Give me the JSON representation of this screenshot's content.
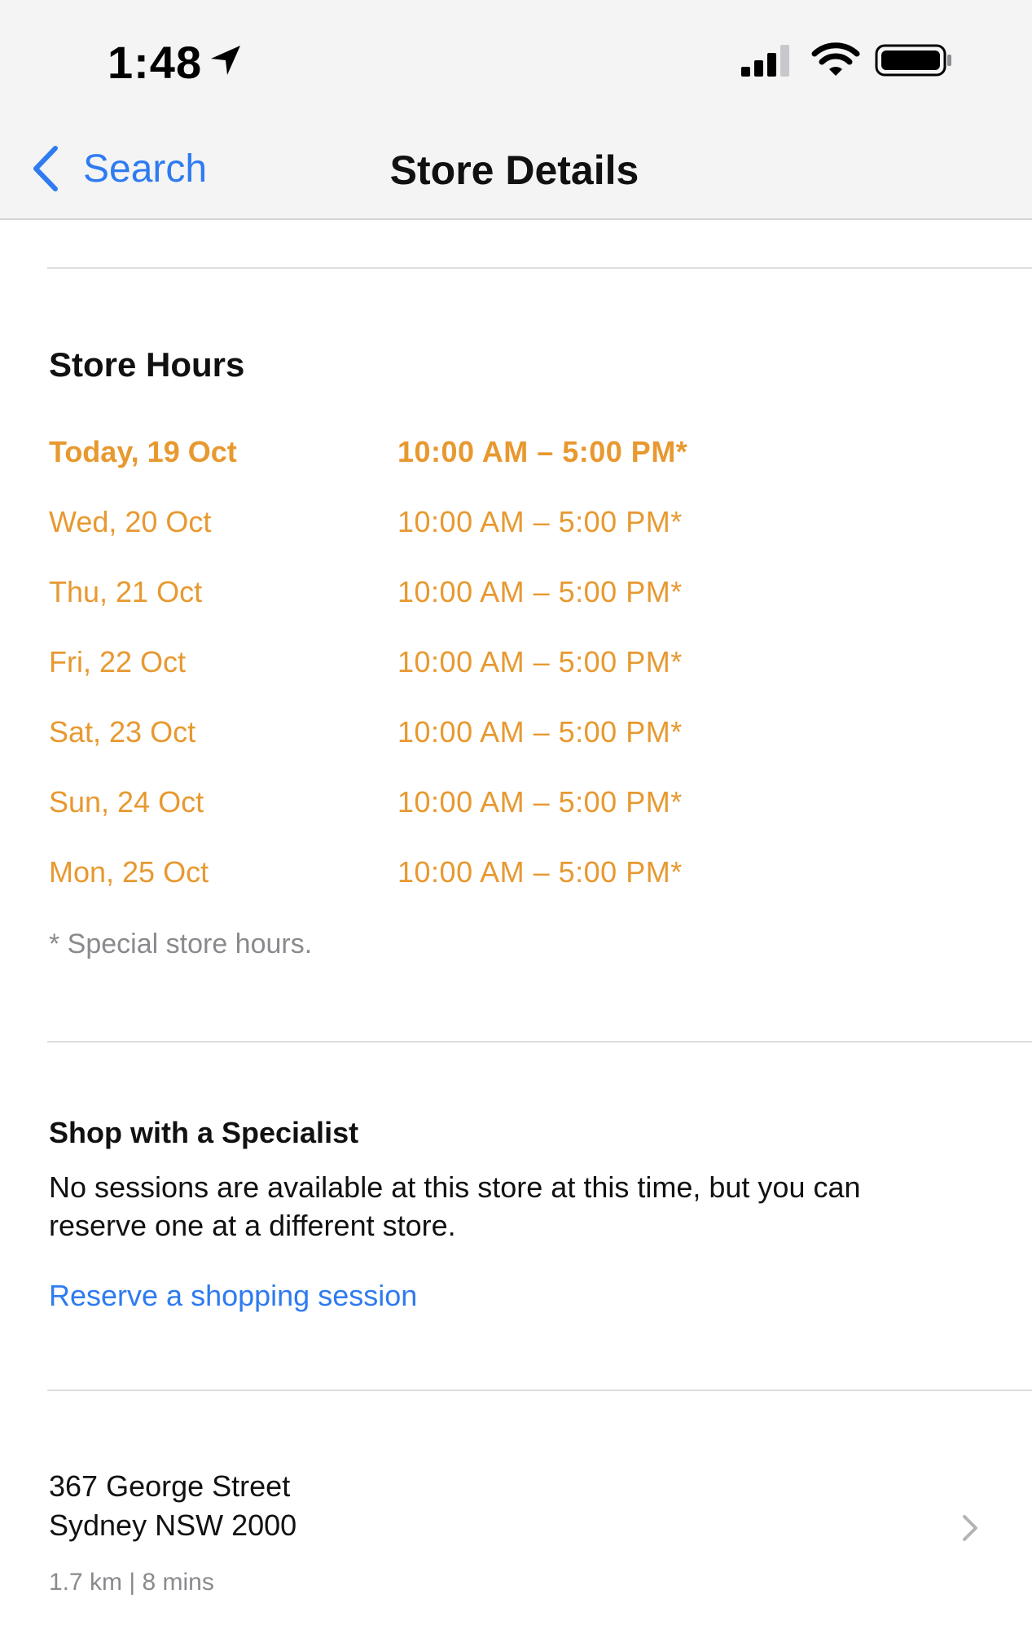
{
  "status_bar": {
    "time": "1:48",
    "icons": [
      "location-arrow-icon",
      "cellular-signal-icon",
      "wifi-icon",
      "battery-icon"
    ]
  },
  "nav": {
    "back_label": "Search",
    "title": "Store Details"
  },
  "store_hours": {
    "title": "Store Hours",
    "rows": [
      {
        "day": "Today, 19 Oct",
        "hours": "10:00 AM – 5:00 PM*",
        "today": true
      },
      {
        "day": "Wed, 20 Oct",
        "hours": "10:00 AM – 5:00 PM*"
      },
      {
        "day": "Thu, 21 Oct",
        "hours": "10:00 AM – 5:00 PM*"
      },
      {
        "day": "Fri, 22 Oct",
        "hours": "10:00 AM – 5:00 PM*"
      },
      {
        "day": "Sat, 23 Oct",
        "hours": "10:00 AM – 5:00 PM*"
      },
      {
        "day": "Sun, 24 Oct",
        "hours": "10:00 AM – 5:00 PM*"
      },
      {
        "day": "Mon, 25 Oct",
        "hours": "10:00 AM – 5:00 PM*"
      }
    ],
    "footnote": "* Special store hours."
  },
  "specialist": {
    "title": "Shop with a Specialist",
    "description": "No sessions are available at this store at this time, but you can reserve one at a different store.",
    "link": "Reserve a shopping session"
  },
  "address": {
    "line1": "367 George Street",
    "line2": "Sydney NSW 2000",
    "distance": "1.7 km | 8 mins"
  },
  "colors": {
    "accent_orange": "#e79930",
    "link_blue": "#2f7bf0",
    "secondary_gray": "#8a8a8e",
    "bar_background": "#f4f4f5"
  }
}
